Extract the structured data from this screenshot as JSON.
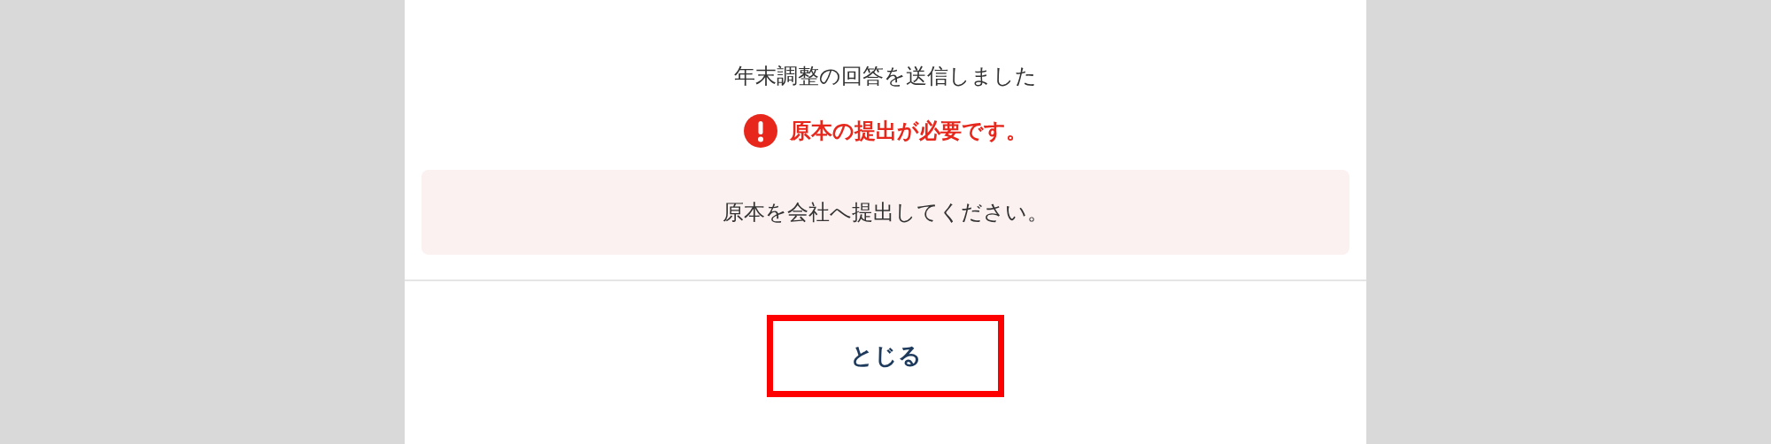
{
  "dialog": {
    "message": "年末調整の回答を送信しました",
    "alert": {
      "text": "原本の提出が必要です。"
    },
    "notice": "原本を会社へ提出してください。",
    "close_button": {
      "label": "とじる",
      "highlighted": true
    }
  }
}
